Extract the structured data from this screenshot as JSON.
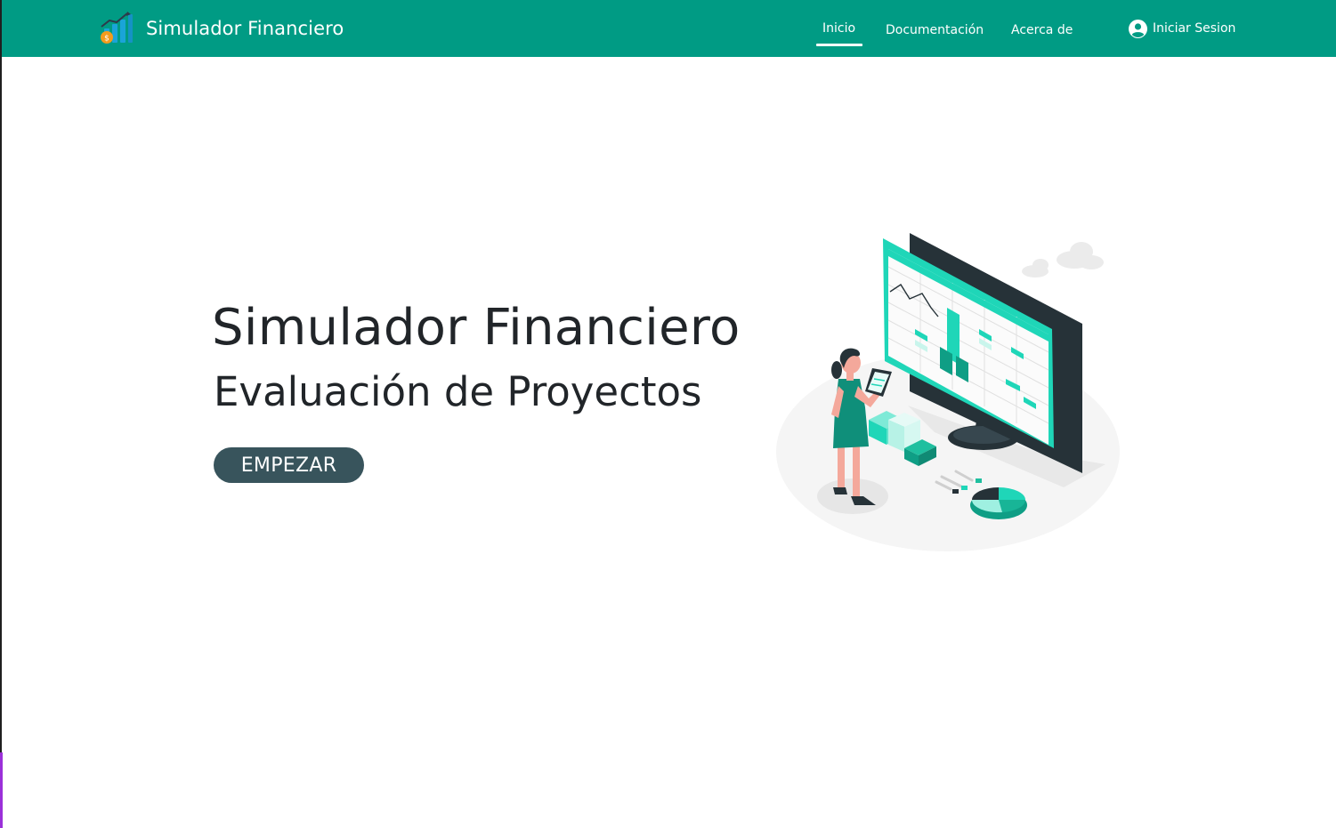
{
  "navbar": {
    "brand_name": "Simulador Financiero",
    "links": [
      {
        "label": "Inicio",
        "active": true
      },
      {
        "label": "Documentación",
        "active": false
      },
      {
        "label": "Acerca de",
        "active": false
      }
    ],
    "login_label": "Iniciar Sesion",
    "brand_icon": "bar-chart-coin-icon",
    "login_icon": "user-circle-icon"
  },
  "hero": {
    "title": "Simulador Financiero",
    "subtitle": "Evaluación de Proyectos",
    "button_label": "EMPEZAR",
    "illustration": "woman-analyzing-spreadsheet-illustration"
  },
  "colors": {
    "navbar_bg": "#009b84",
    "button_bg": "#38545c",
    "text": "#212529",
    "accent_teal": "#1fd6b8",
    "illustration_dark": "#263238"
  }
}
